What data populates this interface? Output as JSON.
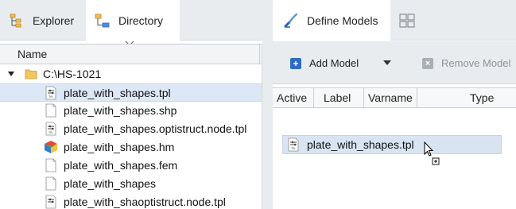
{
  "left_tabs": [
    {
      "label": "Explorer",
      "icon": "explorer-icon"
    },
    {
      "label": "Directory",
      "icon": "directory-icon",
      "active": true
    }
  ],
  "tree": {
    "column_header": "Name",
    "root": {
      "label": "C:\\HS-1021",
      "icon": "folder-icon",
      "expanded": true
    },
    "files": [
      {
        "label": "plate_with_shapes.tpl",
        "icon": "tpl-file-icon",
        "selected": true
      },
      {
        "label": "plate_with_shapes.shp",
        "icon": "blank-file-icon"
      },
      {
        "label": "plate_with_shapes.optistruct.node.tpl",
        "icon": "tpl-file-icon"
      },
      {
        "label": "plate_with_shapes.hm",
        "icon": "hm-cube-icon"
      },
      {
        "label": "plate_with_shapes.fem",
        "icon": "blank-file-icon"
      },
      {
        "label": "plate_with_shapes",
        "icon": "blank-file-icon"
      },
      {
        "label": "plate_with_shaoptistruct.node.tpl",
        "icon": "tpl-file-icon"
      }
    ]
  },
  "right_tabs": [
    {
      "label": "Define Models",
      "icon": "define-models-icon",
      "active": true
    },
    {
      "label": "",
      "icon": "grid-view-icon"
    }
  ],
  "toolbar": {
    "add_label": "Add Model",
    "remove_label": "Remove Model"
  },
  "models_table": {
    "columns": [
      "Active",
      "Label",
      "Varname",
      "Type"
    ]
  },
  "drag_item": {
    "label": "plate_with_shapes.tpl",
    "icon": "tpl-file-icon"
  },
  "colors": {
    "tab_bar": "#e9ecef",
    "selection": "#dde8f7",
    "accent_blue": "#2d6cc0",
    "disabled_grey": "#a9afb5"
  }
}
